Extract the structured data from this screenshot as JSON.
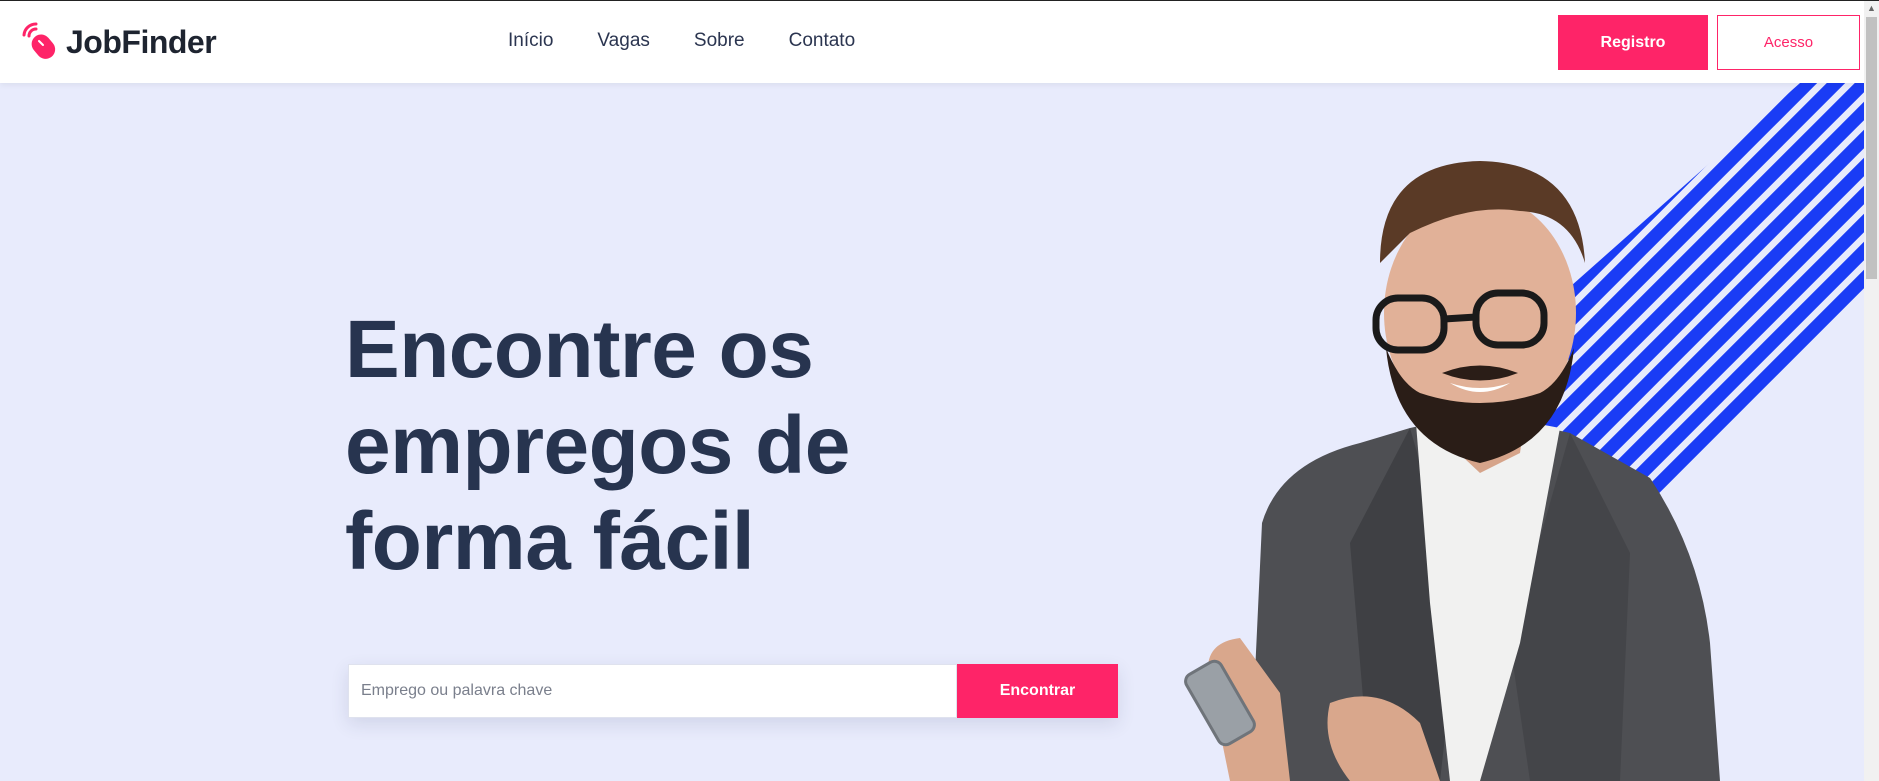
{
  "brand": {
    "name": "JobFinder",
    "accent": "#fe2468",
    "dark": "#27344f",
    "stripe": "#1a3cf5"
  },
  "nav": {
    "links": [
      "Início",
      "Vagas",
      "Sobre",
      "Contato"
    ]
  },
  "auth": {
    "register_label": "Registro",
    "login_label": "Acesso"
  },
  "hero": {
    "title_lines": [
      "Encontre os",
      "empregos de",
      "forma fácil"
    ],
    "search_placeholder": "Emprego ou palavra chave",
    "search_button": "Encontrar"
  },
  "icons": {
    "logo": "mouse-signal-icon",
    "scroll_up": "chevron-up-icon"
  }
}
